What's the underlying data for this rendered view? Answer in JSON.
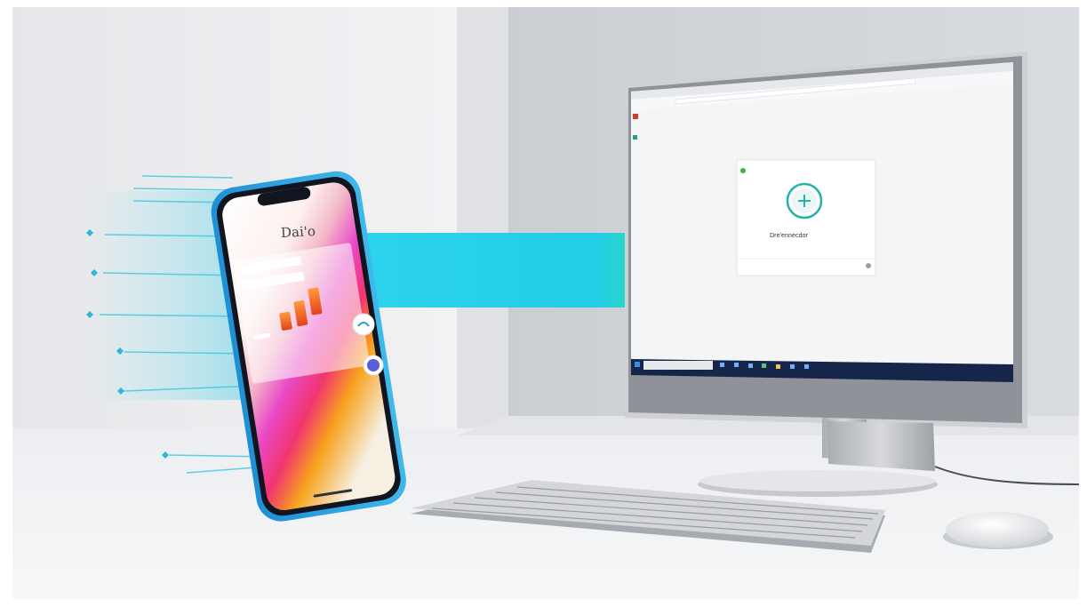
{
  "scene": {
    "phone": {
      "screen_title": "Dai'o",
      "card_items": [
        "",
        ""
      ]
    },
    "monitor": {
      "dialog": {
        "title": "Dre'ennecdor",
        "subtitle": ""
      }
    },
    "colors": {
      "arrow_cyan": "#1fd4e6",
      "arrow_green": "#2ee6a0",
      "phone_blue": "#2a8fd0",
      "taskbar": "#16254a",
      "dialog_icon": "#24b3a8"
    },
    "icons": [
      "arrow-right-icon",
      "dialog-add-icon",
      "windows-start-icon",
      "search-icon",
      "mouse-icon",
      "keyboard-icon"
    ]
  }
}
